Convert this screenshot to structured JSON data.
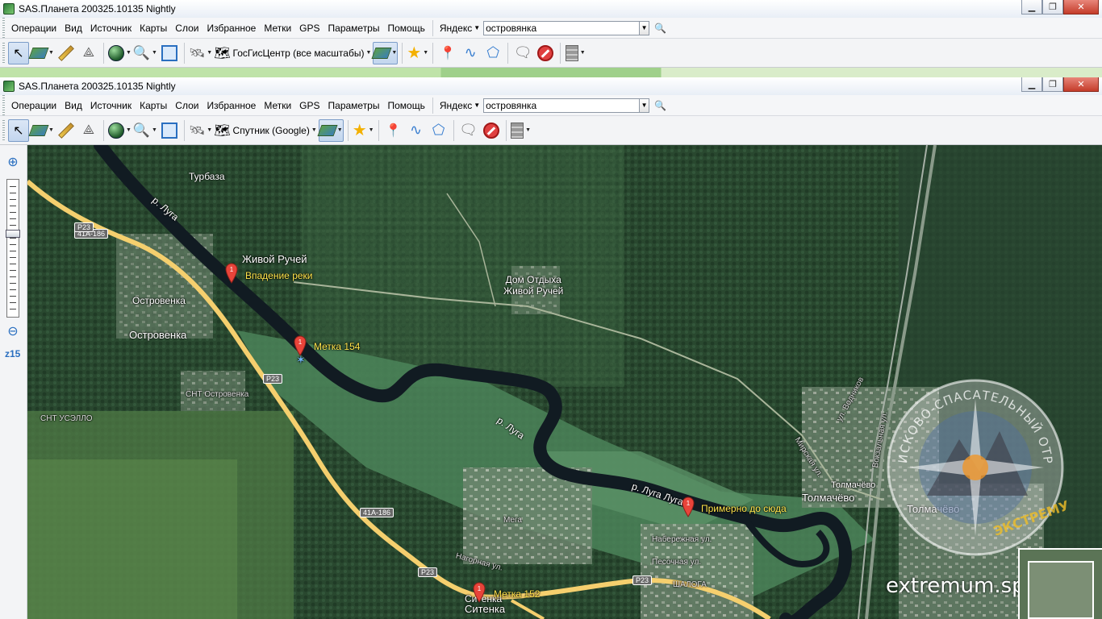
{
  "window1": {
    "title": "SAS.Планета 200325.10135 Nightly",
    "menu": [
      "Операции",
      "Вид",
      "Источник",
      "Карты",
      "Слои",
      "Избранное",
      "Метки",
      "GPS",
      "Параметры",
      "Помощь"
    ],
    "search_provider": "Яндекс",
    "search_value": "островянка",
    "map_source": "ГосГисЦентр (все масштабы)"
  },
  "window2": {
    "title": "SAS.Планета 200325.10135 Nightly",
    "menu": [
      "Операции",
      "Вид",
      "Источник",
      "Карты",
      "Слои",
      "Избранное",
      "Метки",
      "GPS",
      "Параметры",
      "Помощь"
    ],
    "search_provider": "Яндекс",
    "search_value": "островянка",
    "map_source": "Спутник (Google)"
  },
  "zoom": {
    "level_label": "z15"
  },
  "map": {
    "labels": {
      "turbaza": "Турбаза",
      "river_luga_1": "р. Луга",
      "river_luga_2": "р. Луга",
      "river_luga_3": "р. Луга Луга",
      "zhivoy_ruchey": "Живой Ручей",
      "dom_otdykha": "Дом Отдыха\nЖивой Ручей",
      "ostrovenka_small": "Островенка",
      "ostrovenka_big": "Островенка",
      "snt": "СНТ Островенка",
      "snt_usello": "СНТ УСЭЛЛО",
      "metka_small": "Мега",
      "tolmachevo_1": "Толмачёво",
      "tolmachevo_2": "Толмачёво",
      "tolmachevo_3": "Толмачёво",
      "sitenka_1": "Ситенка",
      "sitenka_2": "Ситенка",
      "naberezhnaya": "Набережная ул.",
      "pesochnaya": "Песочная ул.",
      "shaloga": "ШАЛОГА",
      "ul_vodnikov": "ул. Водников",
      "mirskaya": "Мирская ул.",
      "vokzalnaya": "Вокзальная ул.",
      "nagornaya": "Нагорная ул."
    },
    "markers": {
      "vpadenie": "Впадение реки",
      "metka154": "Метка 154",
      "primerno": "Примерно до сюда",
      "metka152": "Метка 152"
    },
    "road_badges": {
      "r41a_1": "41А-186",
      "r41a_2": "41А-186",
      "p23_1": "Р23",
      "p23_2": "Р23",
      "p23_3": "Р23",
      "p23_4": "Р23"
    },
    "emblem": {
      "text": "ПОИСКОВО-СПАСАТЕЛЬНЫЙ ОТРЯД",
      "bottom": "ЭКСТРЕМУМ"
    },
    "watermark": "extremum.spb.ru"
  },
  "colors": {
    "river": "#14202a",
    "road": "#f5cf6e",
    "forest_dark": "#22402c",
    "forest_mid": "#35604a",
    "meadow": "#4f8a5a",
    "marker": "#e8443a"
  }
}
